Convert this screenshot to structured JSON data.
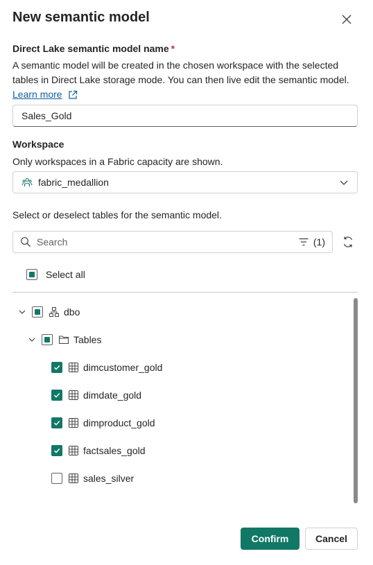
{
  "dialog": {
    "title": "New semantic model",
    "close_icon": "close-icon"
  },
  "name_field": {
    "label": "Direct Lake semantic model name",
    "required_marker": "*",
    "description": "A semantic model will be created in the chosen workspace with the selected tables in Direct Lake storage mode. You can then live edit the semantic model.",
    "learn_more": "Learn more",
    "value": "Sales_Gold"
  },
  "workspace": {
    "label": "Workspace",
    "description": "Only workspaces in a Fabric capacity are shown.",
    "selected": "fabric_medallion",
    "icon": "workspace-icon"
  },
  "tables_section": {
    "instruction": "Select or deselect tables for the semantic model.",
    "search_placeholder": "Search",
    "filter_count": "(1)",
    "select_all_label": "Select all",
    "select_all_state": "partial"
  },
  "tree": {
    "schema": {
      "label": "dbo",
      "state": "partial",
      "expanded": true
    },
    "folder": {
      "label": "Tables",
      "state": "partial",
      "expanded": true
    },
    "tables": [
      {
        "label": "dimcustomer_gold",
        "checked": true
      },
      {
        "label": "dimdate_gold",
        "checked": true
      },
      {
        "label": "dimproduct_gold",
        "checked": true
      },
      {
        "label": "factsales_gold",
        "checked": true
      },
      {
        "label": "sales_silver",
        "checked": false
      }
    ]
  },
  "footer": {
    "confirm": "Confirm",
    "cancel": "Cancel"
  },
  "colors": {
    "accent": "#117865",
    "required": "#c4314b",
    "link": "#115ea3"
  }
}
